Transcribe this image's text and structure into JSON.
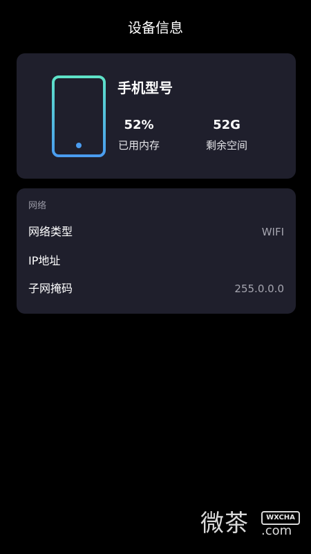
{
  "header": {
    "title": "设备信息"
  },
  "device": {
    "icon": "phone-icon",
    "model_title": "手机型号",
    "used_memory": {
      "value": "52%",
      "label": "已用内存"
    },
    "free_space": {
      "value": "52G",
      "label": "剩余空间"
    },
    "icon_gradient": [
      "#5ee3c8",
      "#4a9cf0"
    ]
  },
  "network": {
    "section_label": "网络",
    "rows": [
      {
        "label": "网络类型",
        "value": "WIFI"
      },
      {
        "label": "IP地址",
        "value": ""
      },
      {
        "label": "子网掩码",
        "value": "255.0.0.0"
      }
    ]
  },
  "watermark": {
    "brand_chars": "微茶",
    "badge": "WXCHA",
    "domain": ".com"
  },
  "colors": {
    "background": "#000000",
    "card": "#1f1f2c",
    "text_primary": "#ffffff",
    "text_secondary": "#a6a6b0"
  }
}
